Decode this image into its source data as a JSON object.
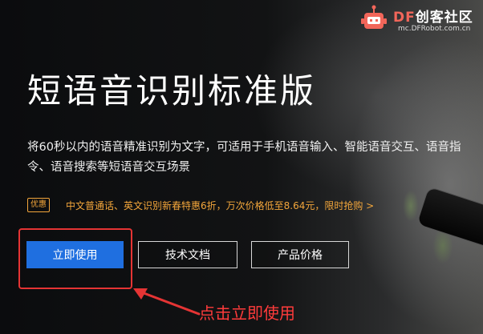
{
  "logo": {
    "brand_prefix": "DF",
    "brand_suffix": "创客社区",
    "url": "mc.DFRobot.com.cn",
    "icon": "robot-icon"
  },
  "hero": {
    "title": "短语音识别标准版",
    "description": "将60秒以内的语音精准识别为文字，可适用于手机语音输入、智能语音交互、语音指令、语音搜索等短语音交互场景"
  },
  "promo": {
    "badge": "优惠",
    "text": "中文普通话、英文识别新春特惠6折，万次价格低至8.64元，限时抢购 >"
  },
  "buttons": {
    "use_now": "立即使用",
    "docs": "技术文档",
    "pricing": "产品价格"
  },
  "annotation": {
    "text": "点击立即使用",
    "color": "#ff3b3b"
  },
  "colors": {
    "primary": "#1f6fe0",
    "promo": "#f3a63b",
    "highlight": "#e53434",
    "brand_red": "#f2665a"
  }
}
